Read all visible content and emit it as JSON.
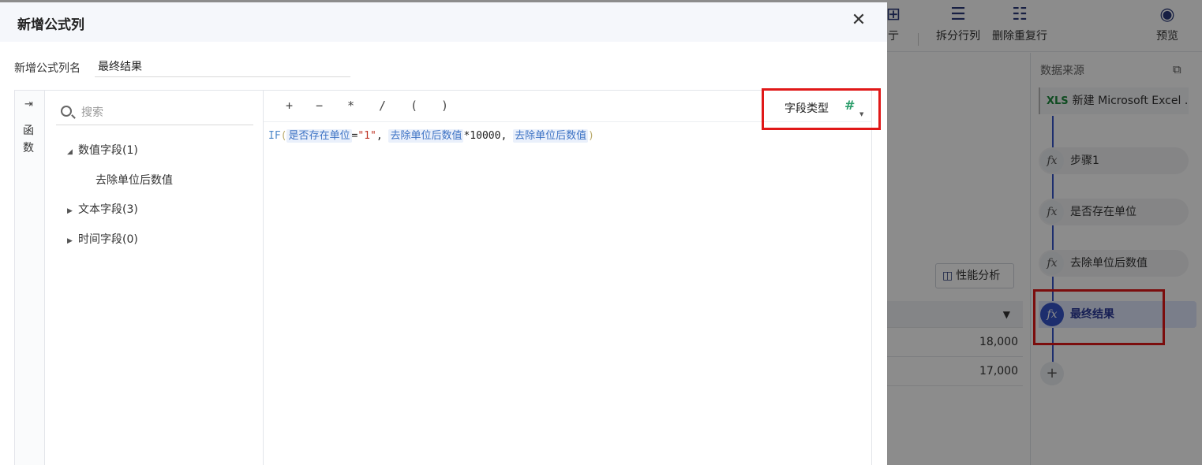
{
  "background": {
    "toolbar": {
      "partial_label": "亍",
      "split_label": "拆分行列",
      "dedupe_label": "删除重复行",
      "preview_label": "预览"
    },
    "sidebar": {
      "title": "数据来源",
      "source_item": "新建 Microsoft Excel ...",
      "steps": [
        {
          "label": "步骤1"
        },
        {
          "label": "是否存在单位"
        },
        {
          "label": "去除单位后数值"
        },
        {
          "label": "最终结果"
        }
      ]
    },
    "perf_button": "性能分析",
    "table_values": [
      "18,000",
      "17,000"
    ]
  },
  "dialog": {
    "title": "新增公式列",
    "name_label": "新增公式列名",
    "name_value": "最终结果",
    "rail_text": "函数",
    "search_placeholder": "搜索",
    "tree": {
      "numeric": "数值字段(1)",
      "numeric_child": "去除单位后数值",
      "text": "文本字段(3)",
      "time": "时间字段(0)"
    },
    "operators": [
      "+",
      "−",
      "*",
      "/",
      "(",
      ")"
    ],
    "field_type_label": "字段类型",
    "formula": {
      "fn": "IF",
      "open": "(",
      "field1": "是否存在单位",
      "eq": "=",
      "str": "\"1\"",
      "comma1": ",",
      "field2": "去除单位后数值",
      "mult": "*10000",
      "comma2": ",",
      "field3": "去除单位后数值",
      "close": ")"
    }
  },
  "colors": {
    "accent": "#3554c9",
    "highlight_box": "#e01818",
    "field_type_icon": "#2a9d6a"
  }
}
